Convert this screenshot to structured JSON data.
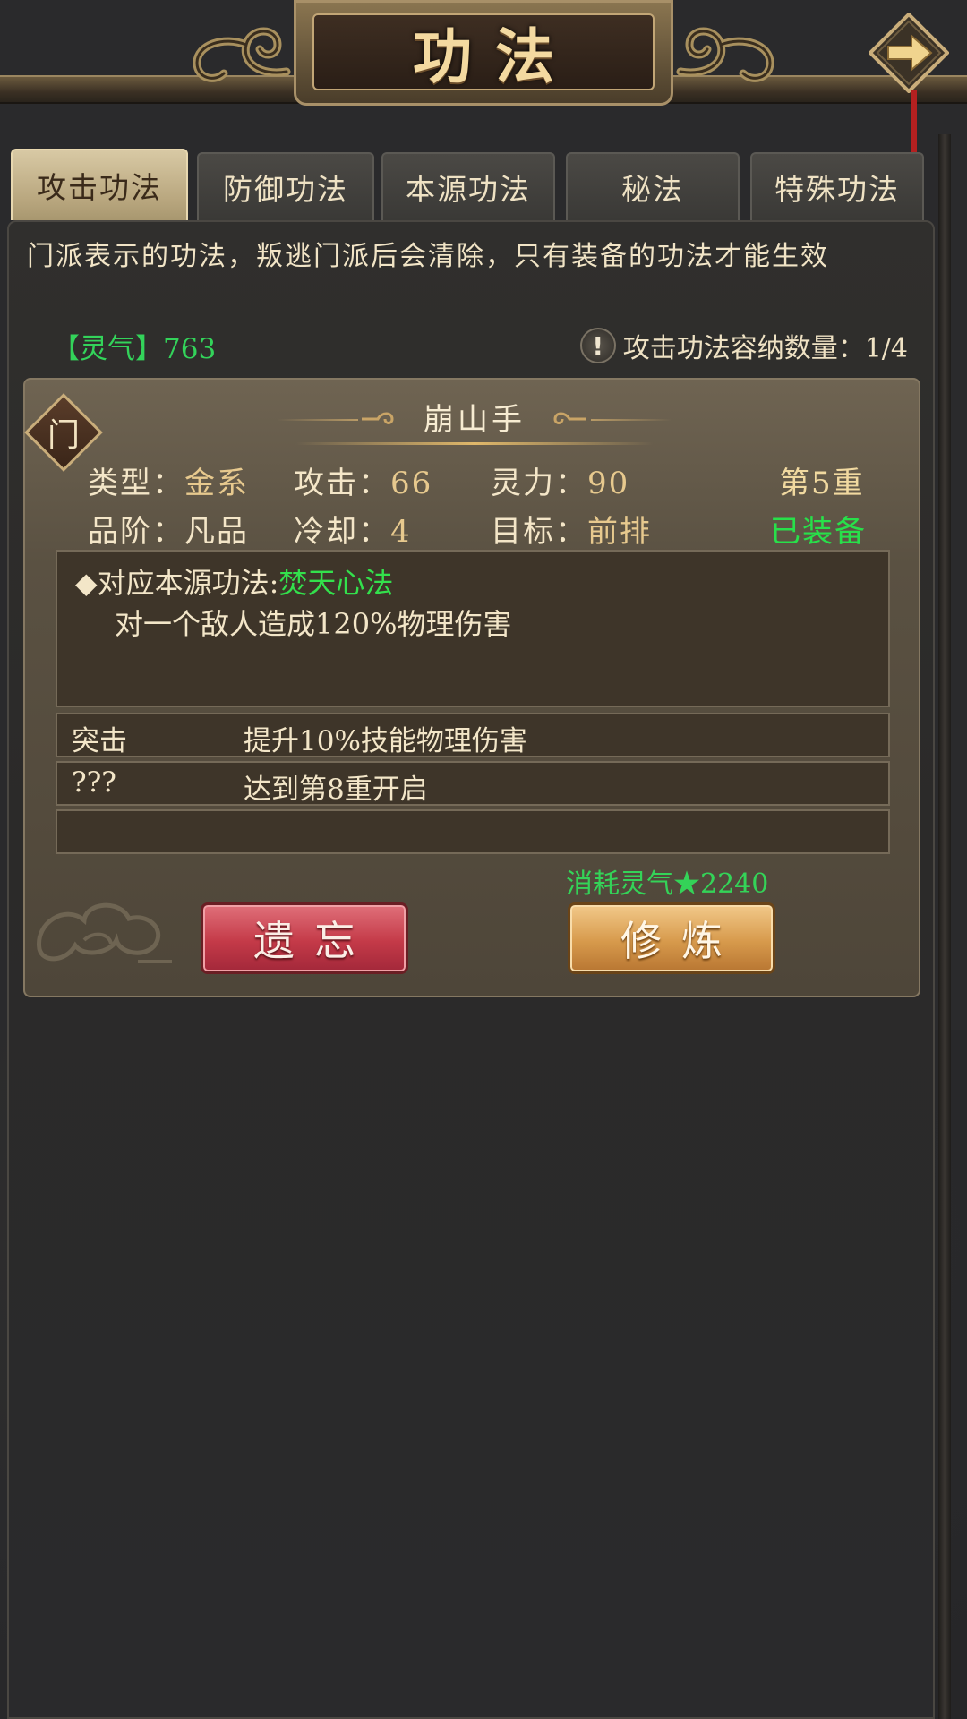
{
  "header": {
    "title": "功法"
  },
  "tabs": [
    {
      "label": "攻击功法",
      "active": true
    },
    {
      "label": "防御功法",
      "active": false
    },
    {
      "label": "本源功法",
      "active": false
    },
    {
      "label": "秘法",
      "active": false
    },
    {
      "label": "特殊功法",
      "active": false
    }
  ],
  "notice": "门派表示的功法，叛逃门派后会清除，只有装备的功法才能生效",
  "resource": {
    "lingqi": "【灵气】763"
  },
  "capacity": {
    "icon": "exclamation-icon",
    "text": "攻击功法容纳数量：1/4"
  },
  "skill": {
    "sect_badge": "门",
    "name": "崩山手",
    "type_label": "类型：",
    "type_value": "金系",
    "attack_label": "攻击：",
    "attack_value": "66",
    "spirit_label": "灵力：",
    "spirit_value": "90",
    "level": "第5重",
    "grade_label": "品阶：",
    "grade_value": "凡品",
    "cooldown_label": "冷却：",
    "cooldown_value": "4",
    "target_label": "目标：",
    "target_value": "前排",
    "status": "已装备",
    "effect_prefix": "◆对应本源功法:",
    "effect_source": "焚天心法",
    "effect_desc": "对一个敌人造成120%物理伤害",
    "rows": [
      {
        "name": "突击",
        "desc": "提升10%技能物理伤害"
      },
      {
        "name": "???",
        "desc": "达到第8重开启"
      },
      {
        "name": "",
        "desc": ""
      }
    ],
    "cost": "消耗灵气★2240"
  },
  "buttons": {
    "forget": "遗忘",
    "train": "修炼"
  },
  "colors": {
    "green": "#33d35a",
    "gold": "#e7c98e",
    "panel": "#2a2a2c"
  }
}
